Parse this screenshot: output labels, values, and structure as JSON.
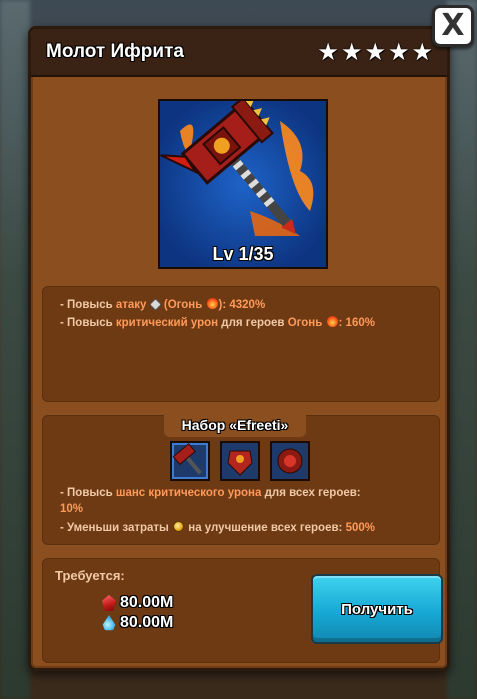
{
  "dialog": {
    "title": "Молот Ифрита",
    "stars": 5,
    "close_label": "X"
  },
  "item": {
    "level": "Lv 1/35"
  },
  "effects": {
    "line1": {
      "prefix": "- Повысь ",
      "stat": "атаку",
      "paren_open": " (",
      "element": "Огонь",
      "paren_close": "): ",
      "value": "4320%"
    },
    "line2": {
      "prefix": "- Повысь ",
      "stat": "критический урон",
      "mid": " для героев ",
      "element": "Огонь",
      "colon": ": ",
      "value": "160%"
    }
  },
  "set": {
    "title": "Набор «Efreeti»",
    "bonus1": {
      "prefix": "- Повысь ",
      "stat": "шанс критического урона",
      "suffix": " для всех героев:",
      "value": "10%"
    },
    "bonus2": {
      "prefix": "- Уменьши затраты ",
      "suffix": " на улучшение всех героев: ",
      "value": "500%"
    }
  },
  "requirements": {
    "label": "Требуется:",
    "resources": [
      {
        "icon": "red-gem-icon",
        "amount": "80.00M"
      },
      {
        "icon": "blue-drop-icon",
        "amount": "80.00M"
      }
    ],
    "action_label": "Получить"
  },
  "colors": {
    "panel": "#6e3a13",
    "highlight": "#ff9a5a",
    "button": "#17a9d3"
  }
}
